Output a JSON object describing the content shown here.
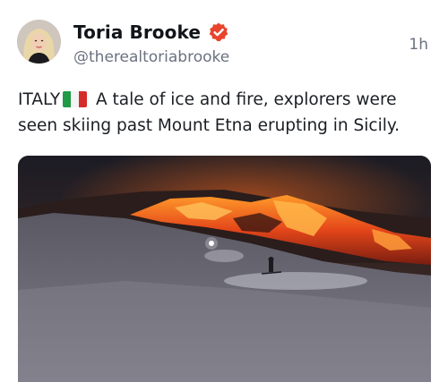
{
  "author": {
    "display_name": "Toria Brooke",
    "handle": "@therealtoriabrooke",
    "verified": true,
    "avatar_icon": "profile-photo"
  },
  "post": {
    "timestamp": "1h",
    "text_prefix": "ITALY",
    "flag_icon": "italy-flag-icon",
    "text_body": "A tale of ice and fire, explorers were seen skiing past Mount Etna erupting in Sicily."
  },
  "media": {
    "kind": "photo",
    "subject": "lava-eruption-snow-slope-skiers"
  },
  "colors": {
    "verified_badge": "#e8452c",
    "flag_green": "#1f9a45",
    "flag_white": "#f4f4f4",
    "flag_red": "#d52b2b",
    "secondary_text": "#6b7280"
  }
}
